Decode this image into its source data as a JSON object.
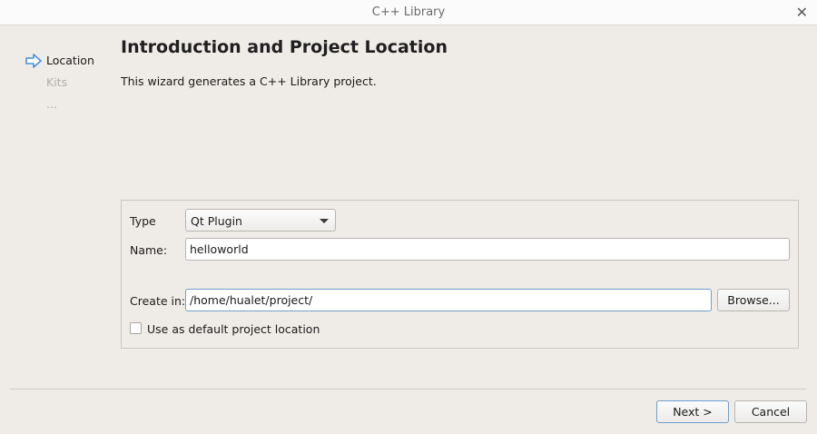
{
  "window": {
    "title": "C++ Library"
  },
  "sidebar": {
    "steps": [
      {
        "label": "Location"
      },
      {
        "label": "Kits"
      },
      {
        "label": "..."
      }
    ]
  },
  "page": {
    "heading": "Introduction and Project Location",
    "description": "This wizard generates a C++ Library project."
  },
  "form": {
    "type_label": "Type",
    "type_value": "Qt Plugin",
    "name_label": "Name:",
    "name_value": "helloworld",
    "createin_label": "Create in:",
    "createin_value": "/home/hualet/project/",
    "browse_label": "Browse...",
    "default_location_label": "Use as default project location",
    "default_location_checked": false
  },
  "footer": {
    "next_label": "Next >",
    "cancel_label": "Cancel"
  },
  "colors": {
    "accent": "#6f9fcd",
    "arrow": "#4a90d9",
    "inactive_text": "#b1ada8"
  }
}
